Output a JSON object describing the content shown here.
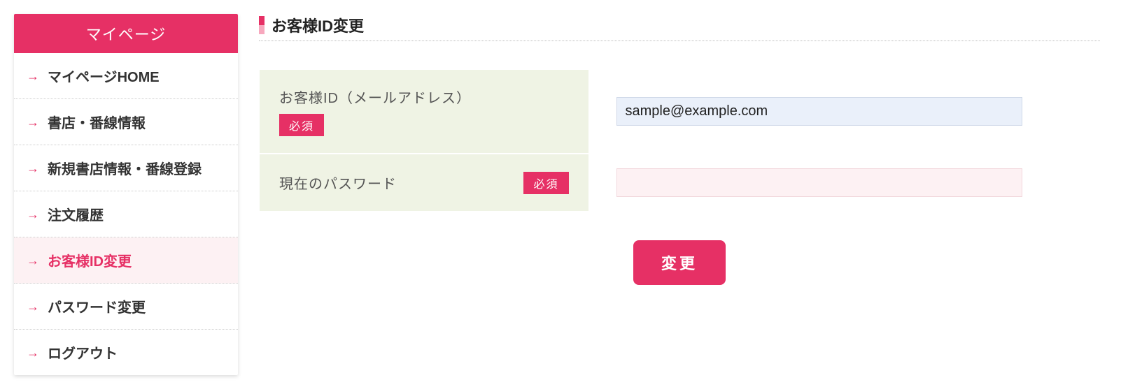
{
  "sidebar": {
    "title": "マイページ",
    "items": [
      {
        "label": "マイページHOME"
      },
      {
        "label": "書店・番線情報"
      },
      {
        "label": "新規書店情報・番線登録"
      },
      {
        "label": "注文履歴"
      },
      {
        "label": "お客様ID変更"
      },
      {
        "label": "パスワード変更"
      },
      {
        "label": "ログアウト"
      }
    ],
    "active_index": 4
  },
  "main": {
    "page_title": "お客様ID変更",
    "fields": {
      "customer_id": {
        "label": "お客様ID（メールアドレス）",
        "required_label": "必須",
        "value": "sample@example.com"
      },
      "current_password": {
        "label": "現在のパスワード",
        "required_label": "必須",
        "value": ""
      }
    },
    "submit_label": "変更"
  }
}
